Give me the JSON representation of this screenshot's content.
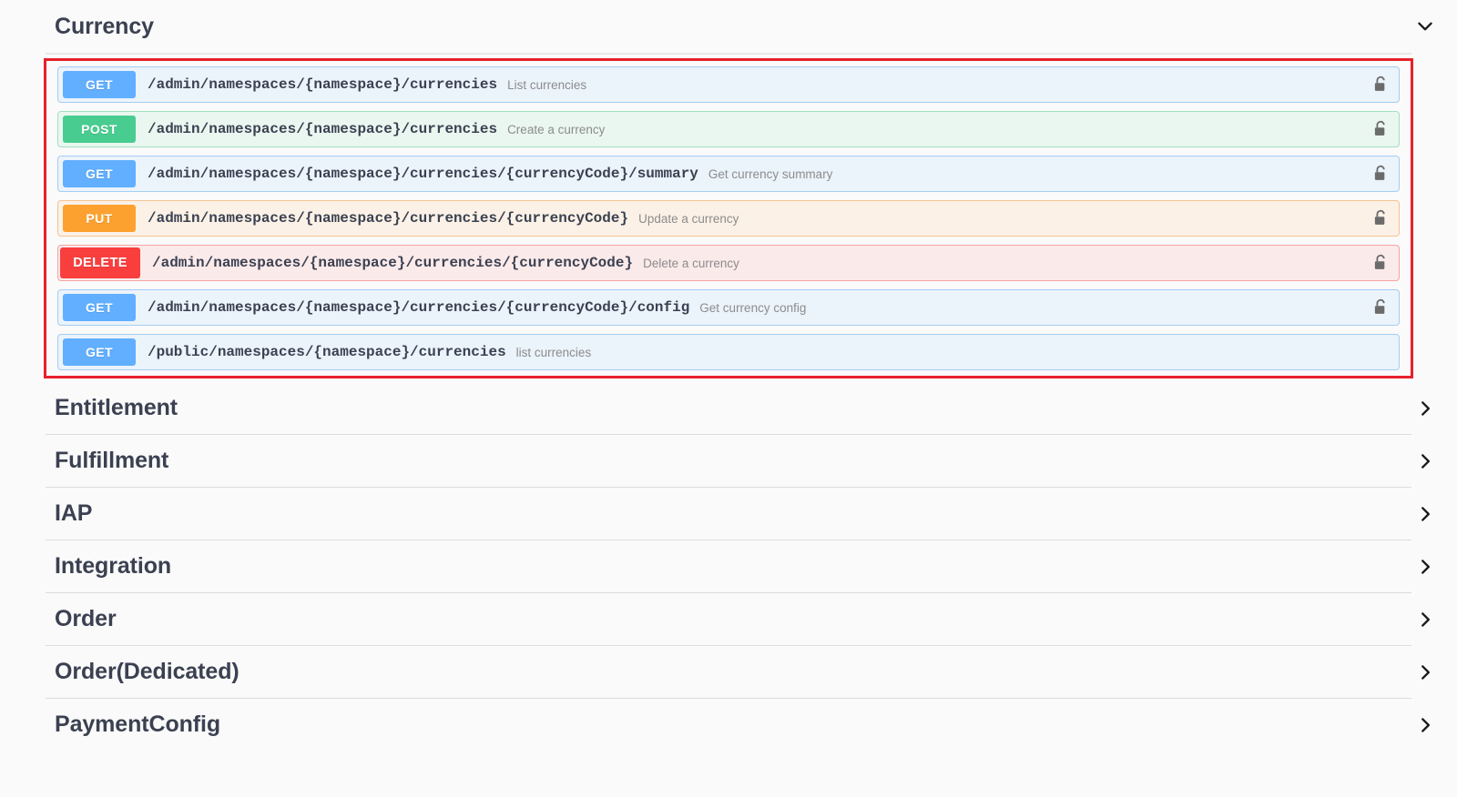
{
  "expanded_tag": {
    "title": "Currency",
    "chevron_icon": "chevron-down-icon",
    "operations": [
      {
        "method": "GET",
        "method_class": "get",
        "path": "/admin/namespaces/{namespace}/currencies",
        "description": "List currencies",
        "lock_icon": "unlocked-padlock-icon",
        "has_lock": true
      },
      {
        "method": "POST",
        "method_class": "post",
        "path": "/admin/namespaces/{namespace}/currencies",
        "description": "Create a currency",
        "lock_icon": "unlocked-padlock-icon",
        "has_lock": true
      },
      {
        "method": "GET",
        "method_class": "get",
        "path": "/admin/namespaces/{namespace}/currencies/{currencyCode}/summary",
        "description": "Get currency summary",
        "lock_icon": "unlocked-padlock-icon",
        "has_lock": true
      },
      {
        "method": "PUT",
        "method_class": "put",
        "path": "/admin/namespaces/{namespace}/currencies/{currencyCode}",
        "description": "Update a currency",
        "lock_icon": "unlocked-padlock-icon",
        "has_lock": true
      },
      {
        "method": "DELETE",
        "method_class": "delete",
        "path": "/admin/namespaces/{namespace}/currencies/{currencyCode}",
        "description": "Delete a currency",
        "lock_icon": "unlocked-padlock-icon",
        "has_lock": true
      },
      {
        "method": "GET",
        "method_class": "get",
        "path": "/admin/namespaces/{namespace}/currencies/{currencyCode}/config",
        "description": "Get currency config",
        "lock_icon": "unlocked-padlock-icon",
        "has_lock": true
      },
      {
        "method": "GET",
        "method_class": "get",
        "path": "/public/namespaces/{namespace}/currencies",
        "description": "list currencies",
        "lock_icon": "",
        "has_lock": false
      }
    ]
  },
  "collapsed_tags": [
    {
      "title": "Entitlement",
      "chevron_icon": "chevron-right-icon"
    },
    {
      "title": "Fulfillment",
      "chevron_icon": "chevron-right-icon"
    },
    {
      "title": "IAP",
      "chevron_icon": "chevron-right-icon"
    },
    {
      "title": "Integration",
      "chevron_icon": "chevron-right-icon"
    },
    {
      "title": "Order",
      "chevron_icon": "chevron-right-icon"
    },
    {
      "title": "Order(Dedicated)",
      "chevron_icon": "chevron-right-icon"
    },
    {
      "title": "PaymentConfig",
      "chevron_icon": "chevron-right-icon"
    }
  ],
  "colors": {
    "get": "#61affe",
    "post": "#49cc90",
    "put": "#fca130",
    "delete": "#f93e3e",
    "highlight_outline": "#e8202a",
    "page_background": "#fafafa",
    "title_text": "#3b4151",
    "description_text": "#8c8c8c"
  }
}
